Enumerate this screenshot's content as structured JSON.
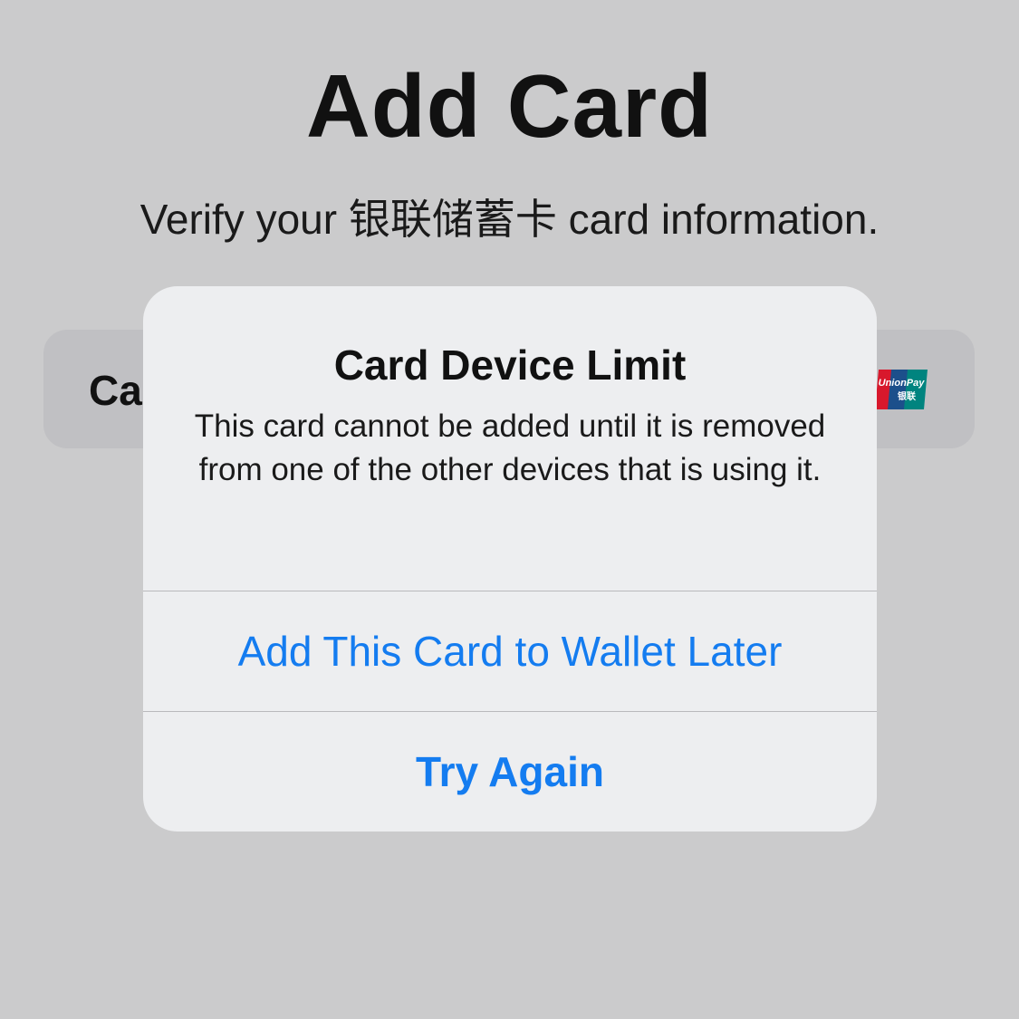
{
  "page": {
    "title": "Add Card",
    "subtitle": "Verify your 银联储蓄卡 card information."
  },
  "card_field": {
    "label_visible": "Ca",
    "logo_icon": "unionpay-logo",
    "logo_text": "UnionPay",
    "logo_text_cn": "银联"
  },
  "alert": {
    "title": "Card Device Limit",
    "message": "This card cannot be added until it is removed from one of the other devices that is using it.",
    "buttons": [
      {
        "label": "Add This Card to Wallet Later"
      },
      {
        "label": "Try Again"
      }
    ]
  },
  "colors": {
    "background": "#cbcbcc",
    "alert_background": "#edeef0",
    "button_blue": "#147cf0",
    "divider": "#b9b9bc",
    "unionpay_red": "#d8182c",
    "unionpay_blue": "#1c4f8b",
    "unionpay_green": "#00847f"
  }
}
